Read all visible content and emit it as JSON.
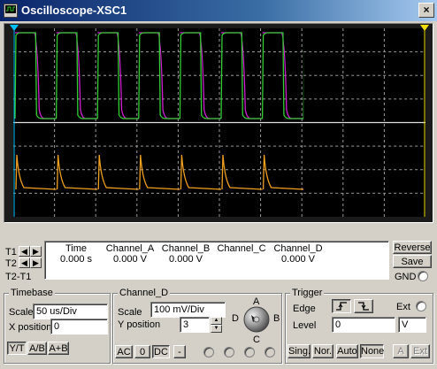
{
  "window": {
    "title": "Oscilloscope-XSC1",
    "close_glyph": "×"
  },
  "readout": {
    "labels": {
      "t1": "T1",
      "t2": "T2",
      "t2t1": "T2-T1"
    },
    "headers": [
      "Time",
      "Channel_A",
      "Channel_B",
      "Channel_C",
      "Channel_D"
    ],
    "values": [
      "0.000 s",
      "0.000 V",
      "0.000 V",
      "",
      "0.000 V"
    ]
  },
  "side_buttons": {
    "reverse": "Reverse",
    "save": "Save",
    "gnd": "GND"
  },
  "timebase": {
    "title": "Timebase",
    "scale_label": "Scale",
    "scale_value": "50 us/Div",
    "xpos_label": "X position",
    "xpos_value": "0",
    "modes": [
      "Y/T",
      "A/B",
      "A+B"
    ]
  },
  "channel": {
    "title": "Channel_D",
    "scale_label": "Scale",
    "scale_value": "100 mV/Div",
    "ypos_label": "Y position",
    "ypos_value": "3",
    "coupling": [
      "AC",
      "0",
      "DC",
      "-"
    ],
    "selector": {
      "a": "A",
      "b": "B",
      "c": "C",
      "d": "D"
    }
  },
  "trigger": {
    "title": "Trigger",
    "edge_label": "Edge",
    "ext_label": "Ext",
    "level_label": "Level",
    "level_value": "0",
    "level_unit": "V",
    "modes": [
      "Sing.",
      "Nor.",
      "Auto",
      "None"
    ],
    "sources": [
      "A",
      "Ext"
    ]
  },
  "colors": {
    "channel_a": "#33cc33",
    "channel_b": "#d020d0",
    "channel_d": "#f0a020",
    "cursor_t1": "#00c0ff",
    "cursor_t2": "#f0e000",
    "screen_bg": "#000000",
    "grid": "#9a9a9a"
  }
}
